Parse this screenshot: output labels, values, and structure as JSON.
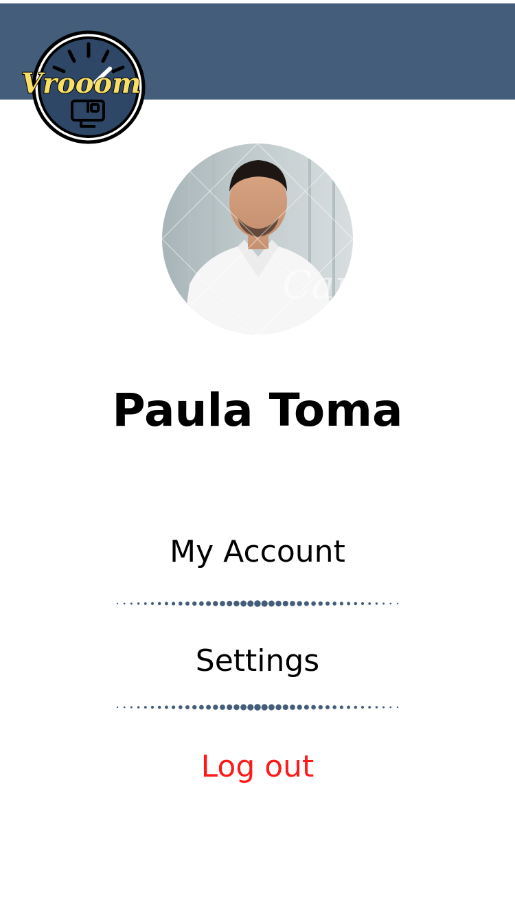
{
  "brand": {
    "name": "Vrooom",
    "colors": {
      "header": "#435d7a",
      "logo_text": "#f9df66",
      "logo_circle": "#2e4766"
    }
  },
  "profile": {
    "name": "Paula Toma",
    "photo_watermark": "Can"
  },
  "menu": {
    "items": [
      {
        "label": "My Account",
        "icon": "none"
      },
      {
        "label": "Settings",
        "icon": "none"
      },
      {
        "label": "Log out",
        "icon": "none",
        "color": "#ff1a1a"
      }
    ]
  }
}
